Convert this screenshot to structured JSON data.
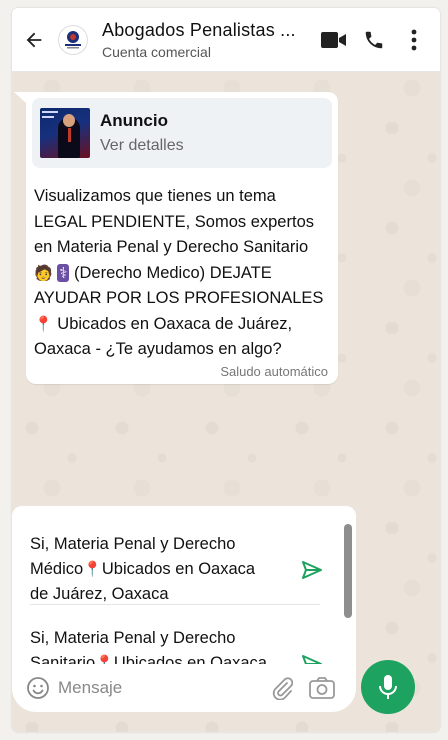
{
  "header": {
    "title": "Abogados Penalistas ...",
    "subtitle": "Cuenta comercial"
  },
  "ad": {
    "title": "Anuncio",
    "subtitle": "Ver detalles"
  },
  "message": {
    "lines": [
      "Visualizamos que tienes un tema",
      "LEGAL PENDIENTE, Somos expertos",
      "en Materia Penal y Derecho Sanitario",
      "(Derecho Medico) DEJATE",
      "AYUDAR POR LOS PROFESIONALES",
      "Ubicados en Oaxaca de Juárez,",
      "Oaxaca - ¿Te ayudamos en algo?"
    ],
    "emoji_worker": "🧑",
    "emoji_medical": "⚕",
    "emoji_pin": "📍",
    "meta": "Saludo automático"
  },
  "quick_replies": [
    {
      "line1": "Si, Materia Penal y Derecho",
      "line2a": "Médico",
      "line2b": "Ubicados en Oaxaca",
      "line3": "de Juárez, Oaxaca"
    },
    {
      "line1": "Si, Materia Penal y Derecho",
      "line2a": "Sanitario",
      "line2b": "Ubicados en Oaxaca"
    }
  ],
  "composer": {
    "placeholder": "Mensaje"
  },
  "colors": {
    "accent_green": "#1da25f",
    "send_icon": "#1da25f",
    "wallpaper": "#ece4da"
  }
}
